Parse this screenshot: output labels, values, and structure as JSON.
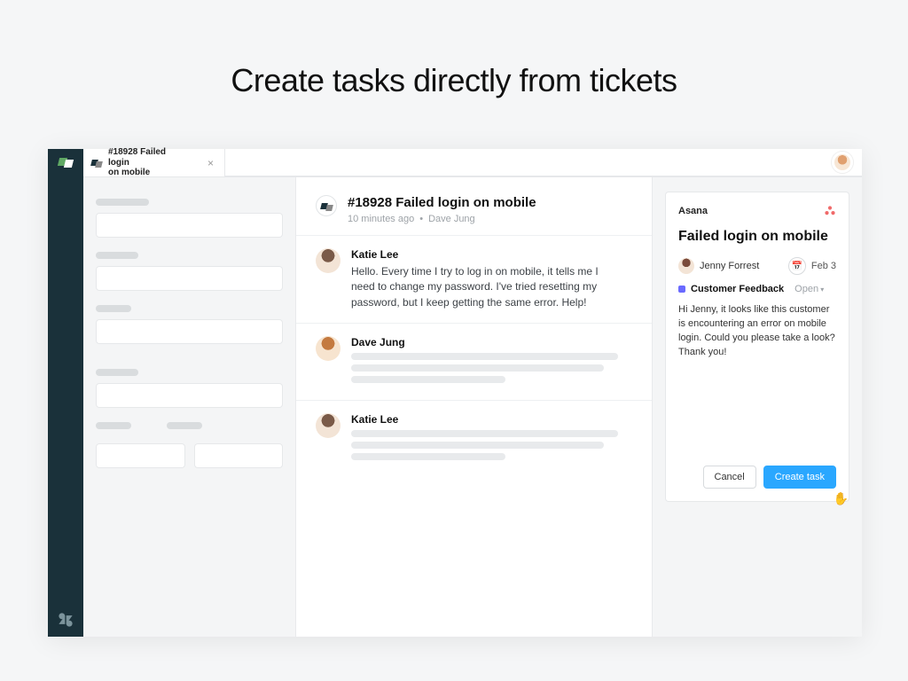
{
  "hero": {
    "title": "Create tasks directly from tickets"
  },
  "tab": {
    "line1": "#18928 Failed login",
    "line2": "on mobile",
    "close": "×"
  },
  "ticket": {
    "title": "#18928 Failed login on mobile",
    "meta_time": "10 minutes ago",
    "meta_author": "Dave Jung"
  },
  "messages": [
    {
      "author": "Katie Lee",
      "avatar": "katie",
      "text": "Hello. Every time I try to log in on mobile, it tells me I need to change my password. I've tried resetting my password, but I keep getting the same error. Help!"
    },
    {
      "author": "Dave Jung",
      "avatar": "dave",
      "text": null
    },
    {
      "author": "Katie Lee",
      "avatar": "katie",
      "text": null
    }
  ],
  "asana": {
    "brand": "Asana",
    "title": "Failed login on mobile",
    "assignee": "Jenny Forrest",
    "due": "Feb 3",
    "project": "Customer Feedback",
    "status": "Open",
    "body": "Hi Jenny, it looks like this customer is encountering an error on mobile login. Could you please take a look? Thank you!",
    "cancel": "Cancel",
    "create": "Create task"
  }
}
